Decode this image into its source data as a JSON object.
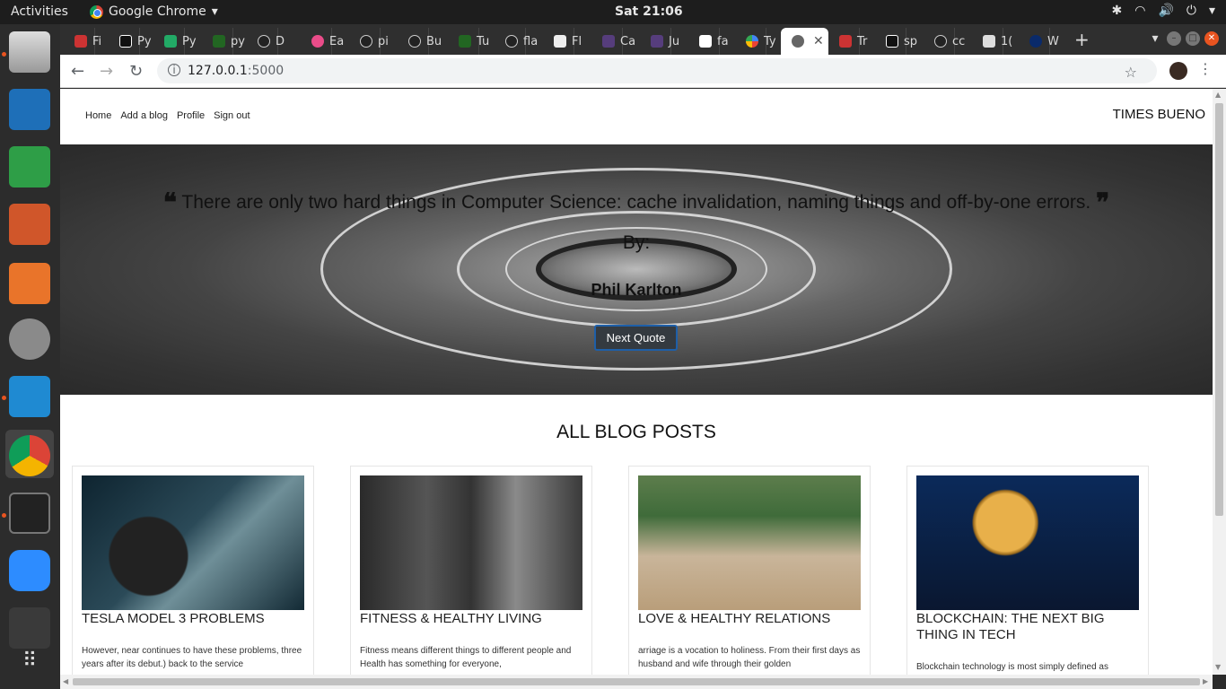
{
  "os": {
    "activities": "Activities",
    "app_name": "Google Chrome",
    "clock": "Sat 21:06"
  },
  "browser": {
    "tabs": [
      "Fi",
      "Py",
      "Py",
      "py",
      "D",
      "Ea",
      "pi",
      "Bu",
      "Tu",
      "fla",
      "Fl",
      "Ca",
      "Ju",
      "fa",
      "Ty",
      "",
      "Tr",
      "sp",
      "cc",
      "1(",
      "W"
    ],
    "url_host": "127.0.0.1",
    "url_port": ":5000"
  },
  "site": {
    "nav": {
      "home": "Home",
      "add_blog": "Add a blog",
      "profile": "Profile",
      "sign_out": "Sign out"
    },
    "brand": "TIMES BUENO",
    "hero": {
      "quote": "There are only two hard things in Computer Science: cache invalidation, naming things and off-by-one errors.",
      "by": "By:",
      "author": "Phil Karlton",
      "next_button": "Next Quote"
    },
    "section_title": "ALL BLOG POSTS",
    "posts": [
      {
        "title": "TESLA MODEL 3 PROBLEMS",
        "excerpt": "However, near continues to have these problems, three years after its debut.) back to the service"
      },
      {
        "title": "FITNESS & HEALTHY LIVING",
        "excerpt": "Fitness means different things to different people and Health has something for everyone,"
      },
      {
        "title": "LOVE & HEALTHY RELATIONS",
        "excerpt": "arriage is a vocation to holiness. From their first days as husband and wife through their golden"
      },
      {
        "title": "BLOCKCHAIN: THE NEXT BIG THING IN TECH",
        "excerpt": "Blockchain technology is most simply defined as"
      }
    ]
  }
}
